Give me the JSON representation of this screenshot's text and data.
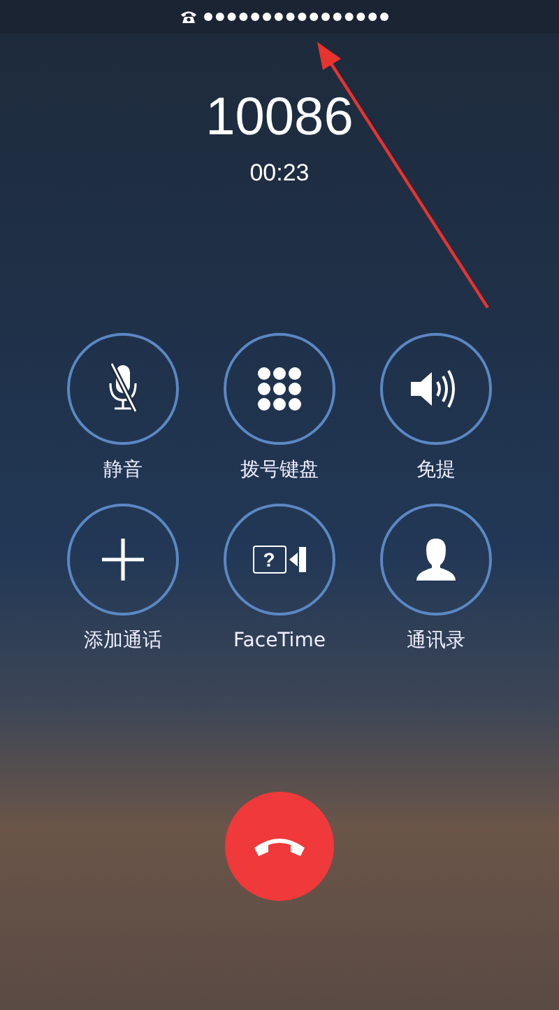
{
  "status_bar": {
    "call_active": true
  },
  "call": {
    "number": "10086",
    "duration": "00:23"
  },
  "controls": [
    {
      "kind": "mute",
      "label": "静音"
    },
    {
      "kind": "keypad",
      "label": "拨号键盘"
    },
    {
      "kind": "speaker",
      "label": "免提"
    },
    {
      "kind": "add",
      "label": "添加通话"
    },
    {
      "kind": "facetime",
      "label": "FaceTime",
      "glyph": "?"
    },
    {
      "kind": "contacts",
      "label": "通讯录"
    }
  ],
  "annotation": {
    "kind": "arrow"
  },
  "end_call": {
    "kind": "hangup"
  }
}
